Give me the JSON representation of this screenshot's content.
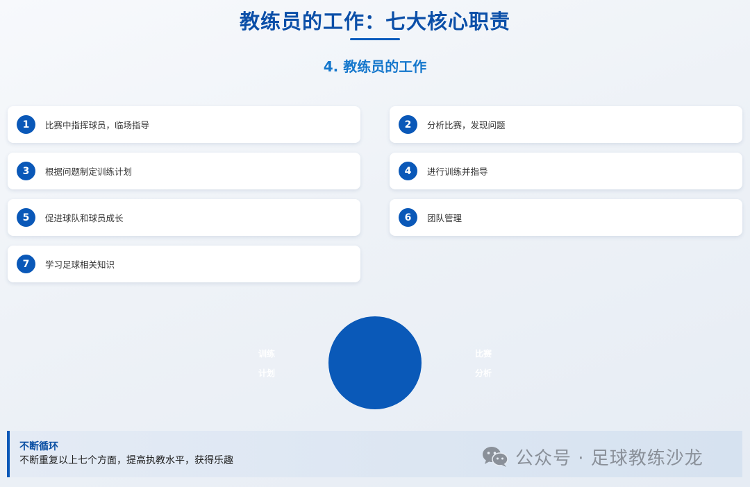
{
  "header": {
    "title": "教练员的工作：七大核心职责",
    "subtitle": "4. 教练员的工作"
  },
  "duties": [
    {
      "num": "1",
      "label": "比赛中指挥球员，临场指导"
    },
    {
      "num": "2",
      "label": "分析比赛，发现问题"
    },
    {
      "num": "3",
      "label": "根据问题制定训练计划"
    },
    {
      "num": "4",
      "label": "进行训练并指导"
    },
    {
      "num": "5",
      "label": "促进球队和球员成长"
    },
    {
      "num": "6",
      "label": "团队管理"
    },
    {
      "num": "7",
      "label": "学习足球相关知识"
    }
  ],
  "cycle": {
    "left_line1": "训练",
    "left_line2": "计划",
    "right_line1": "比赛",
    "right_line2": "分析"
  },
  "footer": {
    "title": "不断循环",
    "description": "不断重复以上七个方面，提高执教水平，获得乐趣"
  },
  "watermark": {
    "text": "公众号 · 足球教练沙龙",
    "icon": "wechat-icon"
  },
  "colors": {
    "primary": "#0a58b8",
    "title": "#0b4fa8",
    "subtitle": "#1577cc"
  }
}
